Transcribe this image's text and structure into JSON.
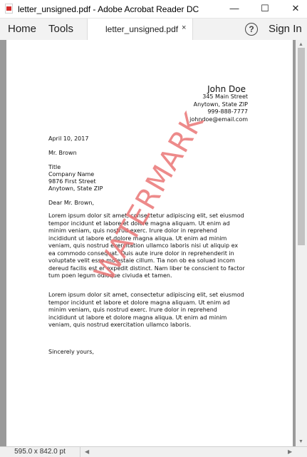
{
  "window": {
    "title": "letter_unsigned.pdf - Adobe Acrobat Reader DC",
    "minimize": "—",
    "maximize": "☐",
    "close": "✕"
  },
  "menu": {
    "home": "Home",
    "tools": "Tools",
    "help": "?",
    "sign_in": "Sign In"
  },
  "tab": {
    "label": "letter_unsigned.pdf",
    "close": "×"
  },
  "letter": {
    "sender_name": "John Doe",
    "sender_address1": "345 Main Street",
    "sender_address2": "Anytown, State ZIP",
    "sender_phone": "999-888-7777",
    "sender_email": "johndoe@email.com",
    "date": "April 10, 2017",
    "recipient": "Mr. Brown",
    "recipient_title": "Title",
    "recipient_company": "Company Name",
    "recipient_address1": "9876 First Street",
    "recipient_address2": "Anytown, State ZIP",
    "salutation": "Dear Mr. Brown,",
    "paragraph1": [
      "Lorem ipsum dolor sit amet, consectetur adipiscing elit, set eiusmod",
      "tempor incidunt et labore et dolore magna aliquam. Ut enim ad",
      "minim veniam, quis nostrud exerc. Irure dolor in reprehend",
      "incididunt ut labore et dolore magna aliqua. Ut enim ad minim",
      "veniam, quis nostrud exercitation ullamco laboris nisi ut aliquip ex",
      "ea commodo consequat. Duis aute irure dolor in reprehenderit in",
      "voluptate velit esse molestaie cillum. Tia non ob ea soluad incom",
      "dereud facilis est er expedit distinct. Nam liber te conscient to factor",
      "tum poen legum odioque civiuda et tamen."
    ],
    "paragraph2": [
      "Lorem ipsum dolor sit amet, consectetur adipiscing elit, set eiusmod",
      "tempor incidunt et labore et dolore magna aliquam. Ut enim ad",
      "minim veniam, quis nostrud exerc. Irure dolor in reprehend",
      "incididunt ut labore et dolore magna aliqua. Ut enim ad minim",
      "veniam, quis nostrud exercitation ullamco laboris."
    ],
    "closing": "Sincerely yours,",
    "watermark": "WATERMARK"
  },
  "status": {
    "page_size": "595.0 x 842.0 pt"
  },
  "colors": {
    "watermark": "#ea7676",
    "pdf_icon": "#d42a2a"
  }
}
